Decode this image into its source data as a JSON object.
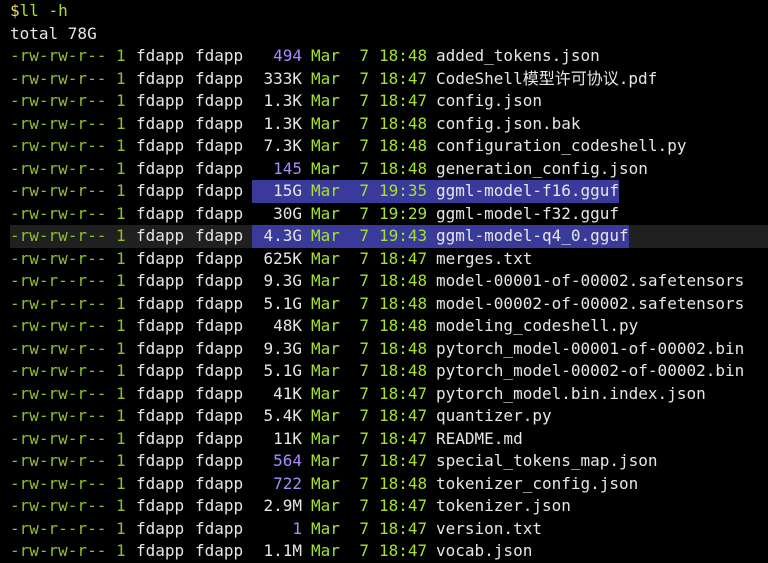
{
  "terminal": {
    "prompt_sign": "$",
    "command": "ll -h",
    "total_line": "total 78G",
    "rows": [
      {
        "perm": "-rw-rw-r--",
        "links": "1",
        "owner": "fdapp",
        "group": "fdapp",
        "size": "494",
        "month": "Mar",
        "day": "7",
        "time": "18:48",
        "name": "added_tokens.json",
        "small": true
      },
      {
        "perm": "-rw-rw-r--",
        "links": "1",
        "owner": "fdapp",
        "group": "fdapp",
        "size": "333K",
        "month": "Mar",
        "day": "7",
        "time": "18:47",
        "name": "CodeShell模型许可协议.pdf"
      },
      {
        "perm": "-rw-rw-r--",
        "links": "1",
        "owner": "fdapp",
        "group": "fdapp",
        "size": "1.3K",
        "month": "Mar",
        "day": "7",
        "time": "18:47",
        "name": "config.json"
      },
      {
        "perm": "-rw-rw-r--",
        "links": "1",
        "owner": "fdapp",
        "group": "fdapp",
        "size": "1.3K",
        "month": "Mar",
        "day": "7",
        "time": "18:48",
        "name": "config.json.bak"
      },
      {
        "perm": "-rw-rw-r--",
        "links": "1",
        "owner": "fdapp",
        "group": "fdapp",
        "size": "7.3K",
        "month": "Mar",
        "day": "7",
        "time": "18:48",
        "name": "configuration_codeshell.py"
      },
      {
        "perm": "-rw-rw-r--",
        "links": "1",
        "owner": "fdapp",
        "group": "fdapp",
        "size": "145",
        "month": "Mar",
        "day": "7",
        "time": "18:48",
        "name": "generation_config.json",
        "small": true
      },
      {
        "perm": "-rw-rw-r--",
        "links": "1",
        "owner": "fdapp",
        "group": "fdapp",
        "size": "15G",
        "month": "Mar",
        "day": "7",
        "time": "19:35",
        "name": "ggml-model-f16.gguf",
        "selected": true
      },
      {
        "perm": "-rw-rw-r--",
        "links": "1",
        "owner": "fdapp",
        "group": "fdapp",
        "size": "30G",
        "month": "Mar",
        "day": "7",
        "time": "19:29",
        "name": "ggml-model-f32.gguf"
      },
      {
        "perm": "-rw-rw-r--",
        "links": "1",
        "owner": "fdapp",
        "group": "fdapp",
        "size": "4.3G",
        "month": "Mar",
        "day": "7",
        "time": "19:43",
        "name": "ggml-model-q4_0.gguf",
        "selected": true,
        "cursor": true
      },
      {
        "perm": "-rw-rw-r--",
        "links": "1",
        "owner": "fdapp",
        "group": "fdapp",
        "size": "625K",
        "month": "Mar",
        "day": "7",
        "time": "18:47",
        "name": "merges.txt"
      },
      {
        "perm": "-rw-r--r--",
        "links": "1",
        "owner": "fdapp",
        "group": "fdapp",
        "size": "9.3G",
        "month": "Mar",
        "day": "7",
        "time": "18:48",
        "name": "model-00001-of-00002.safetensors"
      },
      {
        "perm": "-rw-r--r--",
        "links": "1",
        "owner": "fdapp",
        "group": "fdapp",
        "size": "5.1G",
        "month": "Mar",
        "day": "7",
        "time": "18:48",
        "name": "model-00002-of-00002.safetensors"
      },
      {
        "perm": "-rw-rw-r--",
        "links": "1",
        "owner": "fdapp",
        "group": "fdapp",
        "size": "48K",
        "month": "Mar",
        "day": "7",
        "time": "18:48",
        "name": "modeling_codeshell.py"
      },
      {
        "perm": "-rw-rw-r--",
        "links": "1",
        "owner": "fdapp",
        "group": "fdapp",
        "size": "9.3G",
        "month": "Mar",
        "day": "7",
        "time": "18:48",
        "name": "pytorch_model-00001-of-00002.bin"
      },
      {
        "perm": "-rw-rw-r--",
        "links": "1",
        "owner": "fdapp",
        "group": "fdapp",
        "size": "5.1G",
        "month": "Mar",
        "day": "7",
        "time": "18:48",
        "name": "pytorch_model-00002-of-00002.bin"
      },
      {
        "perm": "-rw-rw-r--",
        "links": "1",
        "owner": "fdapp",
        "group": "fdapp",
        "size": "41K",
        "month": "Mar",
        "day": "7",
        "time": "18:47",
        "name": "pytorch_model.bin.index.json"
      },
      {
        "perm": "-rw-rw-r--",
        "links": "1",
        "owner": "fdapp",
        "group": "fdapp",
        "size": "5.4K",
        "month": "Mar",
        "day": "7",
        "time": "18:47",
        "name": "quantizer.py"
      },
      {
        "perm": "-rw-rw-r--",
        "links": "1",
        "owner": "fdapp",
        "group": "fdapp",
        "size": "11K",
        "month": "Mar",
        "day": "7",
        "time": "18:47",
        "name": "README.md"
      },
      {
        "perm": "-rw-rw-r--",
        "links": "1",
        "owner": "fdapp",
        "group": "fdapp",
        "size": "564",
        "month": "Mar",
        "day": "7",
        "time": "18:47",
        "name": "special_tokens_map.json",
        "small": true
      },
      {
        "perm": "-rw-rw-r--",
        "links": "1",
        "owner": "fdapp",
        "group": "fdapp",
        "size": "722",
        "month": "Mar",
        "day": "7",
        "time": "18:48",
        "name": "tokenizer_config.json",
        "small": true
      },
      {
        "perm": "-rw-rw-r--",
        "links": "1",
        "owner": "fdapp",
        "group": "fdapp",
        "size": "2.9M",
        "month": "Mar",
        "day": "7",
        "time": "18:47",
        "name": "tokenizer.json"
      },
      {
        "perm": "-rw-r--r--",
        "links": "1",
        "owner": "fdapp",
        "group": "fdapp",
        "size": "1",
        "month": "Mar",
        "day": "7",
        "time": "18:47",
        "name": "version.txt",
        "small": true
      },
      {
        "perm": "-rw-rw-r--",
        "links": "1",
        "owner": "fdapp",
        "group": "fdapp",
        "size": "1.1M",
        "month": "Mar",
        "day": "7",
        "time": "18:47",
        "name": "vocab.json"
      }
    ]
  },
  "colors": {
    "background": "#000000",
    "permissions": "#8fbf2a",
    "date": "#a6e22e",
    "small_size": "#a78bfa",
    "selection": "#3a3a9a",
    "text": "#e6e6e6",
    "prompt": "#e6db74"
  }
}
